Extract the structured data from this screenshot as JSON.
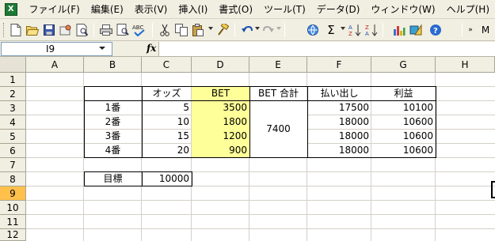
{
  "menu": {
    "app_icon": "excel-icon",
    "items": [
      "ファイル(F)",
      "編集(E)",
      "表示(V)",
      "挿入(I)",
      "書式(O)",
      "ツール(T)",
      "データ(D)",
      "ウィンドウ(W)",
      "ヘルプ(H)"
    ]
  },
  "toolbar": {
    "overflow_label": "M",
    "icons": [
      "new-icon",
      "open-icon",
      "save-icon",
      "permission-icon",
      "print-preview-icon",
      "print-icon",
      "spelling-icon",
      "cut-icon",
      "copy-icon",
      "paste-icon",
      "format-painter-icon",
      "undo-icon",
      "redo-icon",
      "hyperlink-icon",
      "autosum-icon",
      "sort-ascending-icon",
      "sort-descending-icon",
      "chart-wizard-icon",
      "drawing-icon",
      "help-icon"
    ]
  },
  "formula_bar": {
    "name_box": "I9",
    "fx_label": "fx",
    "formula": ""
  },
  "sheet": {
    "columns": [
      "A",
      "B",
      "C",
      "D",
      "E",
      "F",
      "G",
      "H"
    ],
    "rows": [
      "1",
      "2",
      "3",
      "4",
      "5",
      "6",
      "7",
      "8",
      "9",
      "10",
      "11",
      "12"
    ],
    "active_row": "9",
    "active_cell": "I9",
    "headers": {
      "odds": "オッズ",
      "bet": "BET",
      "bet_total": "BET 合計",
      "payout": "払い出し",
      "profit": "利益"
    },
    "entries": [
      {
        "label": "1番",
        "odds": "5",
        "bet": "3500",
        "payout": "17500",
        "profit": "10100"
      },
      {
        "label": "2番",
        "odds": "10",
        "bet": "1800",
        "payout": "18000",
        "profit": "10600"
      },
      {
        "label": "3番",
        "odds": "15",
        "bet": "1200",
        "payout": "18000",
        "profit": "10600"
      },
      {
        "label": "4番",
        "odds": "20",
        "bet": "900",
        "payout": "18000",
        "profit": "10600"
      }
    ],
    "bet_total_value": "7400",
    "target_label": "目標",
    "target_value": "10000",
    "highlight_color": "#ffff99",
    "active_header_color": "#ffc04c"
  }
}
